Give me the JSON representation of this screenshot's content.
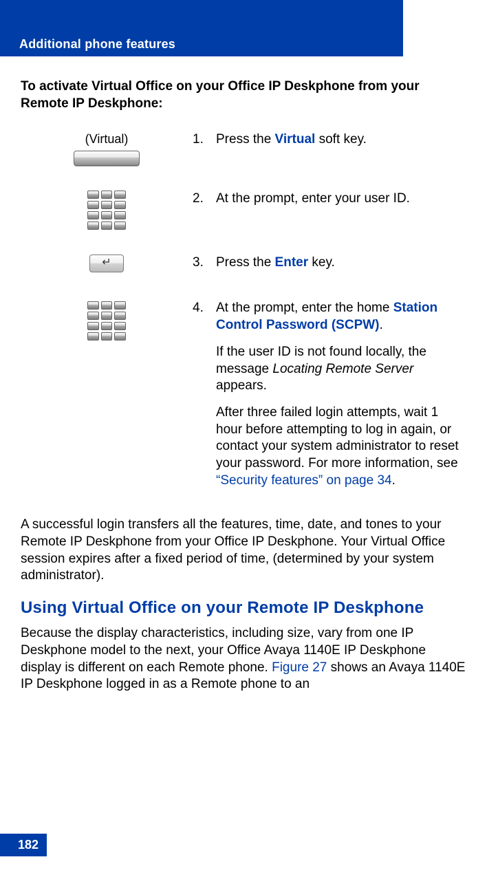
{
  "header": {
    "title": "Additional phone features"
  },
  "intro": "To activate Virtual Office on your Office IP Deskphone from your Remote IP Deskphone:",
  "steps": [
    {
      "illus_label": "(Virtual)",
      "num": "1.",
      "text_pre": "Press the ",
      "text_link": "Virtual",
      "text_post": " soft key."
    },
    {
      "num": "2.",
      "text": "At the prompt, enter your user ID."
    },
    {
      "num": "3.",
      "text_pre": "Press the ",
      "text_link": "Enter",
      "text_post": " key."
    },
    {
      "num": "4.",
      "text_pre": "At the prompt, enter the home ",
      "text_link": "Station Control Password (SCPW)",
      "text_post": ".",
      "para2_pre": "If the user ID is not found locally, the message ",
      "para2_italic": "Locating Remote Server",
      "para2_post": " appears.",
      "para3_pre": "After three failed login attempts, wait 1 hour before attempting to log in again, or contact your system administrator to reset your password. For more information, see ",
      "para3_link": "“Security features” on page 34",
      "para3_post": "."
    }
  ],
  "body_para": "A successful login transfers all the features, time, date, and tones to your Remote IP Deskphone from your Office IP Deskphone. Your Virtual Office session expires after a fixed period of time, (determined by your system administrator).",
  "section_heading": "Using Virtual Office on your Remote IP Deskphone",
  "section_para_pre": "Because the display characteristics, including size, vary from one IP Deskphone model to the next, your Office Avaya 1140E IP Deskphone display is different on each Remote phone. ",
  "section_para_link": "Figure 27",
  "section_para_post": " shows an Avaya 1140E IP Deskphone logged in as a Remote phone to an",
  "page_number": "182"
}
